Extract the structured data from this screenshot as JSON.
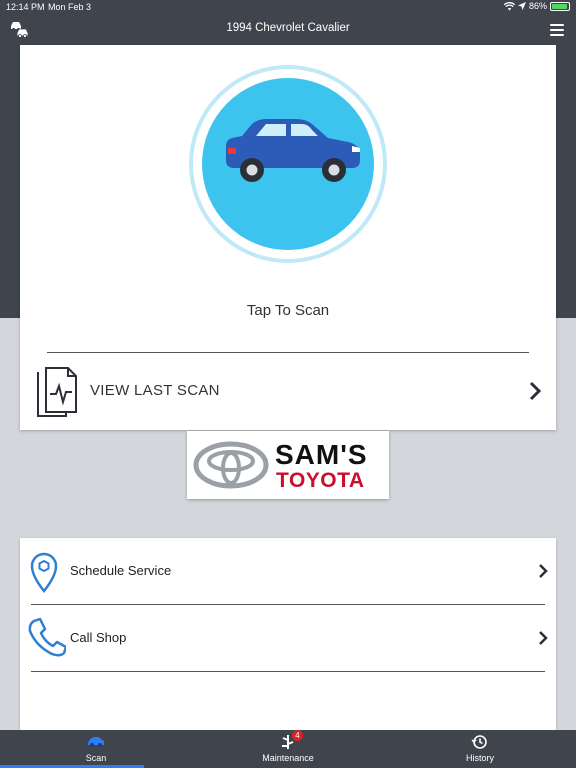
{
  "status_bar": {
    "time": "12:14 PM",
    "date": "Mon Feb 3",
    "battery": "86%",
    "battery_level": 0.86
  },
  "header": {
    "title": "1994 Chevrolet Cavalier",
    "left_icon": "cars-icon",
    "right_icon": "hamburger-menu-icon"
  },
  "scan_card": {
    "tap_label": "Tap To Scan",
    "last_scan_label": "VIEW LAST SCAN"
  },
  "dealer_logo": {
    "line1": "SAM'S",
    "line2": "TOYOTA"
  },
  "actions": [
    {
      "label": "Schedule Service",
      "icon": "location-pin-icon"
    },
    {
      "label": "Call Shop",
      "icon": "phone-icon"
    }
  ],
  "tabs": [
    {
      "label": "Scan",
      "icon": "car-icon",
      "active": true
    },
    {
      "label": "Maintenance",
      "icon": "maintenance-icon",
      "badge": "4"
    },
    {
      "label": "History",
      "icon": "history-icon"
    }
  ],
  "colors": {
    "header_bg": "#3f444d",
    "page_bg": "#d3d7dc",
    "scan_circle": "#3cc4ee",
    "car_body": "#2d5bb8",
    "accent": "#2f7df6",
    "brand_red": "#c8102e",
    "icon_blue": "#2e7fd6"
  }
}
